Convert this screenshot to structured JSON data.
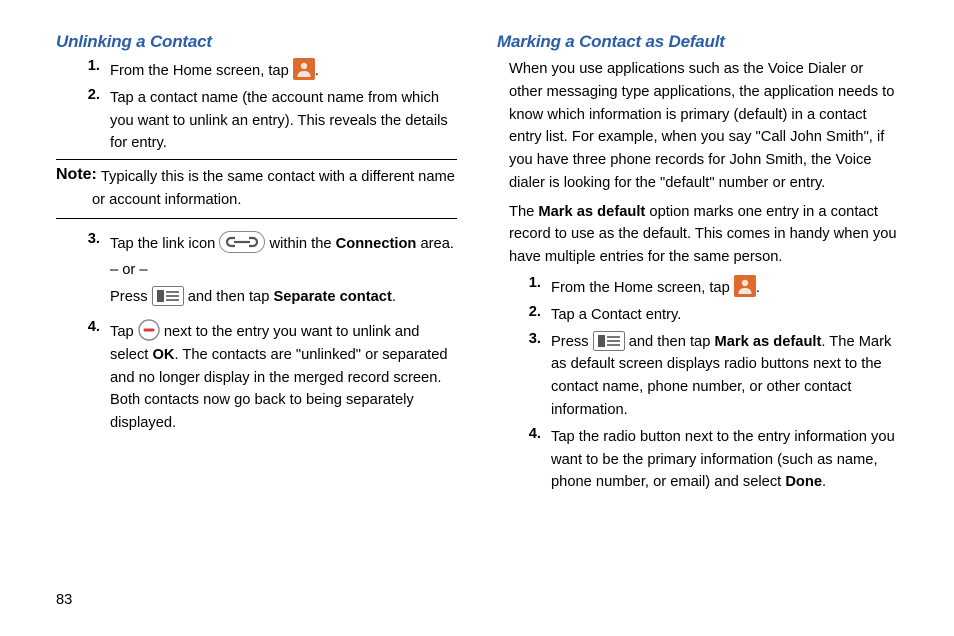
{
  "left": {
    "title": "Unlinking a Contact",
    "s1_a": "From the Home screen, tap ",
    "s1_b": ".",
    "s2": "Tap a contact name (the account name from which you want to unlink an entry). This reveals the details for entry.",
    "note_label": "Note:",
    "note_1": "Typically this is the same contact with a different name",
    "note_2": "or account information.",
    "s3_a": "Tap the link icon ",
    "s3_b": " within the ",
    "s3_c": "Connection",
    "s3_d": " area.",
    "s3_or": "– or –",
    "s3_pa": "Press ",
    "s3_pb": " and then tap ",
    "s3_pc": "Separate contact",
    "s3_pd": ".",
    "s4_a": "Tap ",
    "s4_b": " next to the entry you want to unlink and select ",
    "s4_c": "OK",
    "s4_d": ". The contacts are \"unlinked\" or separated and no longer display in the merged record screen. Both contacts now go back to being separately displayed."
  },
  "right": {
    "title": "Marking a Contact as Default",
    "p1": "When you use applications such as the Voice Dialer or other messaging type applications, the application needs to know which information is primary (default) in a contact entry list. For example, when you say \"Call John Smith\", if you have three phone records for John Smith, the Voice dialer is looking for the \"default\" number or entry.",
    "p2_a": "The ",
    "p2_b": "Mark as default",
    "p2_c": " option marks one entry in a contact record to use as the default. This comes in handy when you have multiple entries for the same person.",
    "s1_a": "From the Home screen, tap ",
    "s1_b": ".",
    "s2": "Tap a Contact entry.",
    "s3_a": "Press ",
    "s3_b": " and then tap ",
    "s3_c": "Mark as default",
    "s3_d": ". The Mark as default screen displays radio buttons next to the contact name, phone number, or other contact information.",
    "s4_a": "Tap the radio button next to the entry information you want to be the primary information (such as name, phone number, or email) and select ",
    "s4_b": "Done",
    "s4_c": "."
  },
  "nums": {
    "n1": "1.",
    "n2": "2.",
    "n3": "3.",
    "n4": "4."
  },
  "page_number": "83"
}
